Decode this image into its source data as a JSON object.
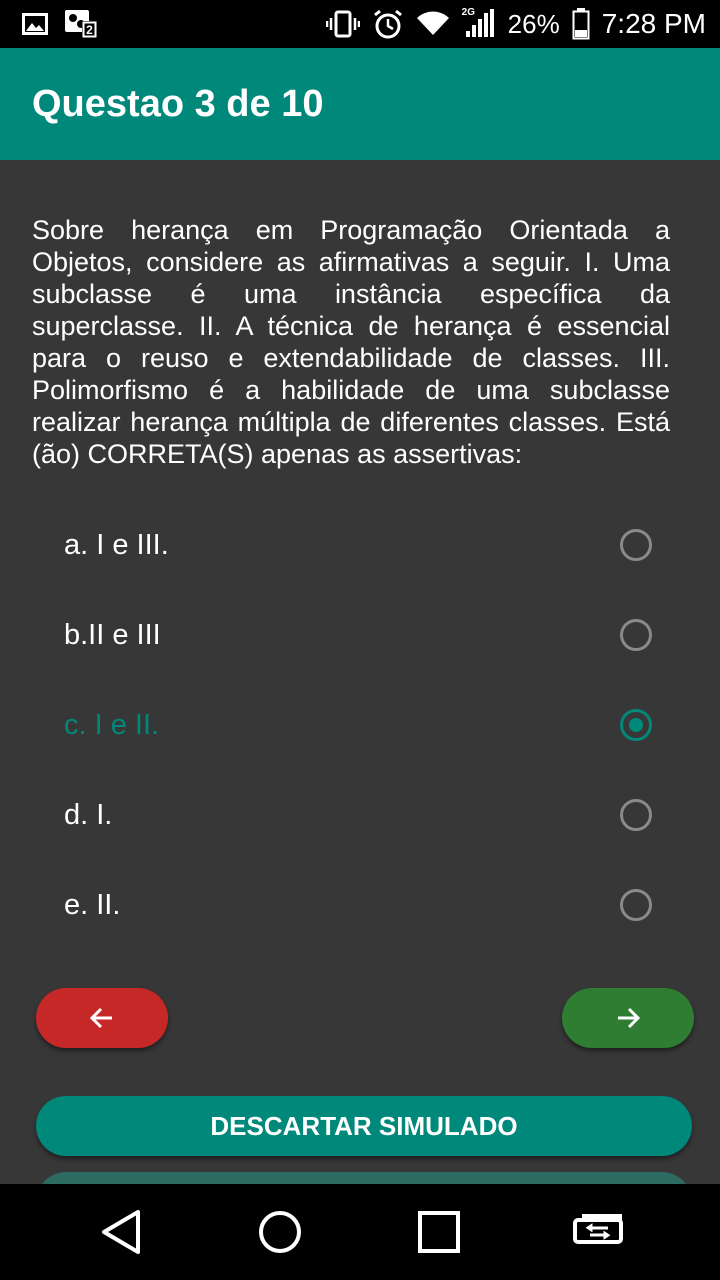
{
  "status_bar": {
    "icons": [
      "image-icon",
      "sim-2-icon",
      "vibrate-icon",
      "alarm-icon",
      "wifi-icon",
      "signal-2g-icon",
      "battery-icon"
    ],
    "network_label": "2G",
    "battery_percent": "26%",
    "time": "7:28 PM"
  },
  "app_bar": {
    "title": "Questao 3 de 10",
    "color": "#00887a"
  },
  "question": {
    "text": "Sobre herança em Programação Orientada a Objetos, considere as afirmativas a seguir. I. Uma subclasse é uma instância específica da superclasse. II. A técnica de herança é essencial para o reuso e extendabilidade de classes. III. Polimorfismo é a habilidade de uma subclasse realizar herança múltipla de diferentes classes. Está (ão) CORRETA(S) apenas as assertivas:"
  },
  "options": [
    {
      "label": "a. I e III.",
      "selected": false
    },
    {
      "label": "b.II e III",
      "selected": false
    },
    {
      "label": "c. I e II.",
      "selected": true
    },
    {
      "label": "d. I.",
      "selected": false
    },
    {
      "label": "e. II.",
      "selected": false
    }
  ],
  "buttons": {
    "prev": {
      "icon": "arrow-left-icon",
      "color": "#c62828"
    },
    "next": {
      "icon": "arrow-right-icon",
      "color": "#2e7d32"
    },
    "discard": {
      "label": "DESCARTAR SIMULADO",
      "color": "#00887a"
    }
  },
  "nav_bar": {
    "icons": [
      "back-icon",
      "home-icon",
      "recents-icon",
      "switch-icon"
    ]
  }
}
